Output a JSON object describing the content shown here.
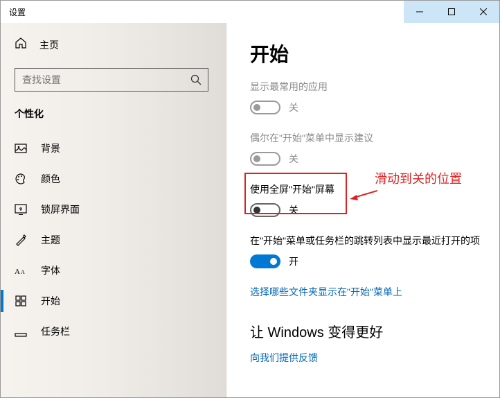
{
  "window": {
    "title": "设置"
  },
  "winbuttons": {
    "min": "minimize",
    "max": "maximize",
    "close": "close"
  },
  "sidebar": {
    "home": "主页",
    "search_placeholder": "查找设置",
    "section": "个性化",
    "items": [
      {
        "label": "背景",
        "icon": "picture"
      },
      {
        "label": "颜色",
        "icon": "palette"
      },
      {
        "label": "锁屏界面",
        "icon": "lock"
      },
      {
        "label": "主题",
        "icon": "brush"
      },
      {
        "label": "字体",
        "icon": "font"
      },
      {
        "label": "开始",
        "icon": "start",
        "selected": true
      },
      {
        "label": "任务栏",
        "icon": "taskbar"
      }
    ]
  },
  "content": {
    "heading": "开始",
    "opt1": {
      "label": "显示最常用的应用",
      "state": "关",
      "disabled": true
    },
    "opt2": {
      "label": "偶尔在\"开始\"菜单中显示建议",
      "state": "关",
      "disabled": true
    },
    "opt3": {
      "label": "使用全屏\"开始\"屏幕",
      "state": "关",
      "disabled": false
    },
    "opt4": {
      "label": "在\"开始\"菜单或任务栏的跳转列表中显示最近打开的项",
      "state": "开",
      "disabled": false,
      "on": true
    },
    "link1": "选择哪些文件夹显示在\"开始\"菜单上",
    "heading2": "让 Windows 变得更好",
    "link2": "向我们提供反馈"
  },
  "annotation": {
    "text": "滑动到关的位置"
  }
}
